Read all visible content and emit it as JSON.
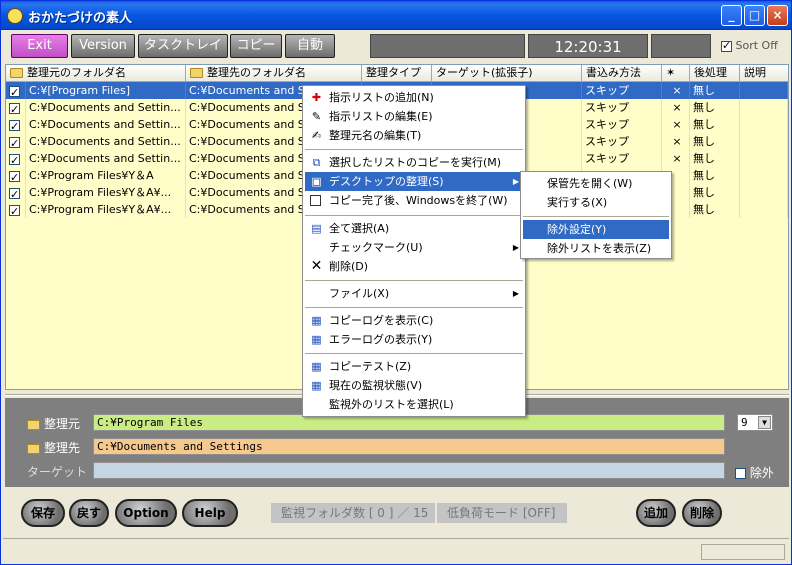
{
  "window": {
    "title": "おかたづけの素人"
  },
  "toolbar": {
    "exit": "Exit",
    "version": "Version",
    "tasktray": "タスクトレイ",
    "copy": "コピー",
    "auto": "自動",
    "clock": "12:20:31",
    "sort_off": "Sort Off"
  },
  "columns": [
    "整理元のフォルダ名",
    "整理先のフォルダ名",
    "整理タイプ",
    "ターゲット(拡張子)",
    "書込み方法",
    "後処理",
    "説明"
  ],
  "rows": [
    {
      "src": "C:¥[Program Files]",
      "dst": "C:¥Documents and Set",
      "method": "スキップ",
      "mark": "×",
      "post": "無し",
      "selected": true
    },
    {
      "src": "C:¥Documents and Settin...",
      "dst": "C:¥Documents and Se",
      "method": "スキップ",
      "mark": "×",
      "post": "無し"
    },
    {
      "src": "C:¥Documents and Settin...",
      "dst": "C:¥Documents and Se",
      "method": "スキップ",
      "mark": "×",
      "post": "無し"
    },
    {
      "src": "C:¥Documents and Settin...",
      "dst": "C:¥Documents and Se",
      "method": "スキップ",
      "mark": "×",
      "post": "無し"
    },
    {
      "src": "C:¥Documents and Settin...",
      "dst": "C:¥Documents and Se",
      "method": "スキップ",
      "mark": "×",
      "post": "無し"
    },
    {
      "src": "C:¥Program Files¥Y＆A",
      "dst": "C:¥Documents and Se",
      "method": "",
      "mark": "",
      "post": "無し"
    },
    {
      "src": "C:¥Program Files¥Y＆A¥...",
      "dst": "C:¥Documents and Se",
      "method": "",
      "mark": "",
      "post": "無し"
    },
    {
      "src": "C:¥Program Files¥Y＆A¥...",
      "dst": "C:¥Documents and Se",
      "method": "",
      "mark": "",
      "post": "無し"
    }
  ],
  "context_menu": {
    "items": [
      "指示リストの追加(N)",
      "指示リストの編集(E)",
      "整理元名の編集(T)",
      "選択したリストのコピーを実行(M)",
      "デスクトップの整理(S)",
      "コピー完了後、Windowsを終了(W)",
      "全て選択(A)",
      "チェックマーク(U)",
      "削除(D)",
      "ファイル(X)",
      "コピーログを表示(C)",
      "エラーログの表示(Y)",
      "コピーテスト(Z)",
      "現在の監視状態(V)",
      "監視外のリストを選択(L)"
    ]
  },
  "submenu": {
    "items": [
      "保管先を開く(W)",
      "実行する(X)",
      "除外設定(Y)",
      "除外リストを表示(Z)"
    ]
  },
  "form": {
    "src_label": "整理元",
    "src_value": "C:¥Program Files",
    "dst_label": "整理先",
    "dst_value": "C:¥Documents and Settings",
    "target_label": "ターゲット",
    "target_value": "",
    "number": "9",
    "exclude": "除外"
  },
  "buttons": {
    "save": "保存",
    "back": "戻す",
    "option": "Option",
    "help": "Help",
    "add": "追加",
    "delete": "削除"
  },
  "status": {
    "watch": "監視フォルダ数 [ 0 ] ／ 15",
    "lowload": "低負荷モード [OFF]"
  },
  "colors": {
    "accent": "#316ac5",
    "list_bg": "#fffdc8",
    "src_field": "#c9ec84",
    "dst_field": "#f5c98d",
    "target_field": "#c5d6e3"
  }
}
